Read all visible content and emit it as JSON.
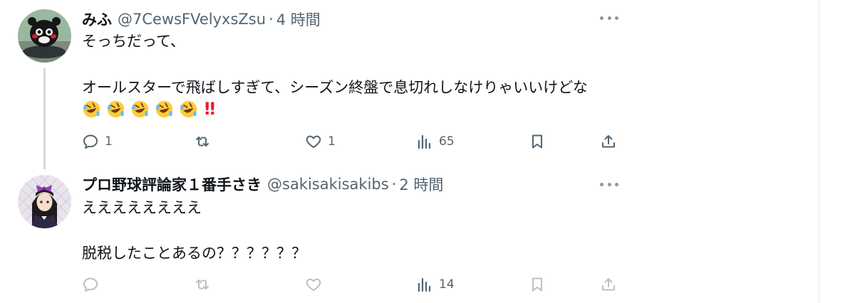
{
  "tweets": [
    {
      "name": "みふ",
      "handle": "@7CewsFVelyxsZsu",
      "separator": "·",
      "time": "4 時間",
      "lines": [
        "そっちだって、",
        "オールスターで飛ばしすぎて、シーズン終盤で息切れしなけりゃいいけどな"
      ],
      "emoji": [
        "rolling-on-floor-laughing",
        "rolling-on-floor-laughing",
        "rolling-on-floor-laughing",
        "rolling-on-floor-laughing",
        "rolling-on-floor-laughing"
      ],
      "emoji_suffix": "‼",
      "actions": {
        "reply": "1",
        "retweet": "",
        "like": "1",
        "views": "65"
      }
    },
    {
      "name": "プロ野球評論家１番手さき",
      "handle": "@sakisakisakibs",
      "separator": "·",
      "time": "2 時間",
      "lines": [
        "ええええええええ",
        "脱税したことあるの？？？？？？"
      ],
      "actions": {
        "reply": "",
        "retweet": "",
        "like": "",
        "views": "14"
      }
    }
  ],
  "colors": {
    "text": "#0f1419",
    "secondary": "#536471",
    "thread_line": "#cfd9de",
    "emphasis": "#f0142d"
  },
  "icons": {
    "reply": "reply-icon",
    "retweet": "retweet-icon",
    "like": "heart-icon",
    "views": "bar-chart-icon",
    "bookmark": "bookmark-icon",
    "share": "share-icon",
    "more": "more-icon"
  }
}
